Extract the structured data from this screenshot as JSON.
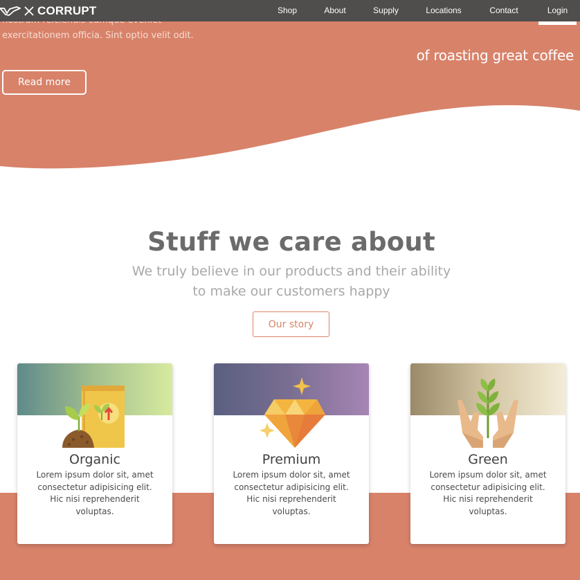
{
  "brand": {
    "name": "CORRUPT",
    "logo_icon": "bird-logo-icon",
    "x_icon": "close-x-icon"
  },
  "nav": {
    "items": [
      {
        "label": "Shop"
      },
      {
        "label": "About"
      },
      {
        "label": "Supply"
      },
      {
        "label": "Locations"
      },
      {
        "label": "Contact"
      },
      {
        "label": "Login"
      }
    ],
    "active": "Login"
  },
  "hero": {
    "text_line1": "nostrum reiciendis cumque eveniet",
    "text_line2": "exercitationem officia. Sint optio velit odit.",
    "tagline": "of roasting great coffee",
    "read_more_label": "Read more",
    "background_color": "#d8826a"
  },
  "care": {
    "title": "Stuff we care about",
    "subtitle_line1": "We truly believe in our products and their ability",
    "subtitle_line2": "to make our customers happy",
    "button_label": "Our story",
    "accent_color": "#d88468"
  },
  "cards": [
    {
      "title": "Organic",
      "desc_line1": "Lorem ipsum dolor sit, amet",
      "desc_line2": "consectetur adipisicing elit.",
      "desc_line3": "Hic nisi reprehenderit",
      "desc_line4": "voluptas.",
      "icon": "seed-bag-sprout-icon"
    },
    {
      "title": "Premium",
      "desc_line1": "Lorem ipsum dolor sit, amet",
      "desc_line2": "consectetur adipisicing elit.",
      "desc_line3": "Hic nisi reprehenderit",
      "desc_line4": "voluptas.",
      "icon": "diamond-sparkle-icon"
    },
    {
      "title": "Green",
      "desc_line1": "Lorem ipsum dolor sit, amet",
      "desc_line2": "consectetur adipisicing elit.",
      "desc_line3": "Hic nisi reprehenderit",
      "desc_line4": "voluptas.",
      "icon": "hands-plant-icon"
    }
  ]
}
